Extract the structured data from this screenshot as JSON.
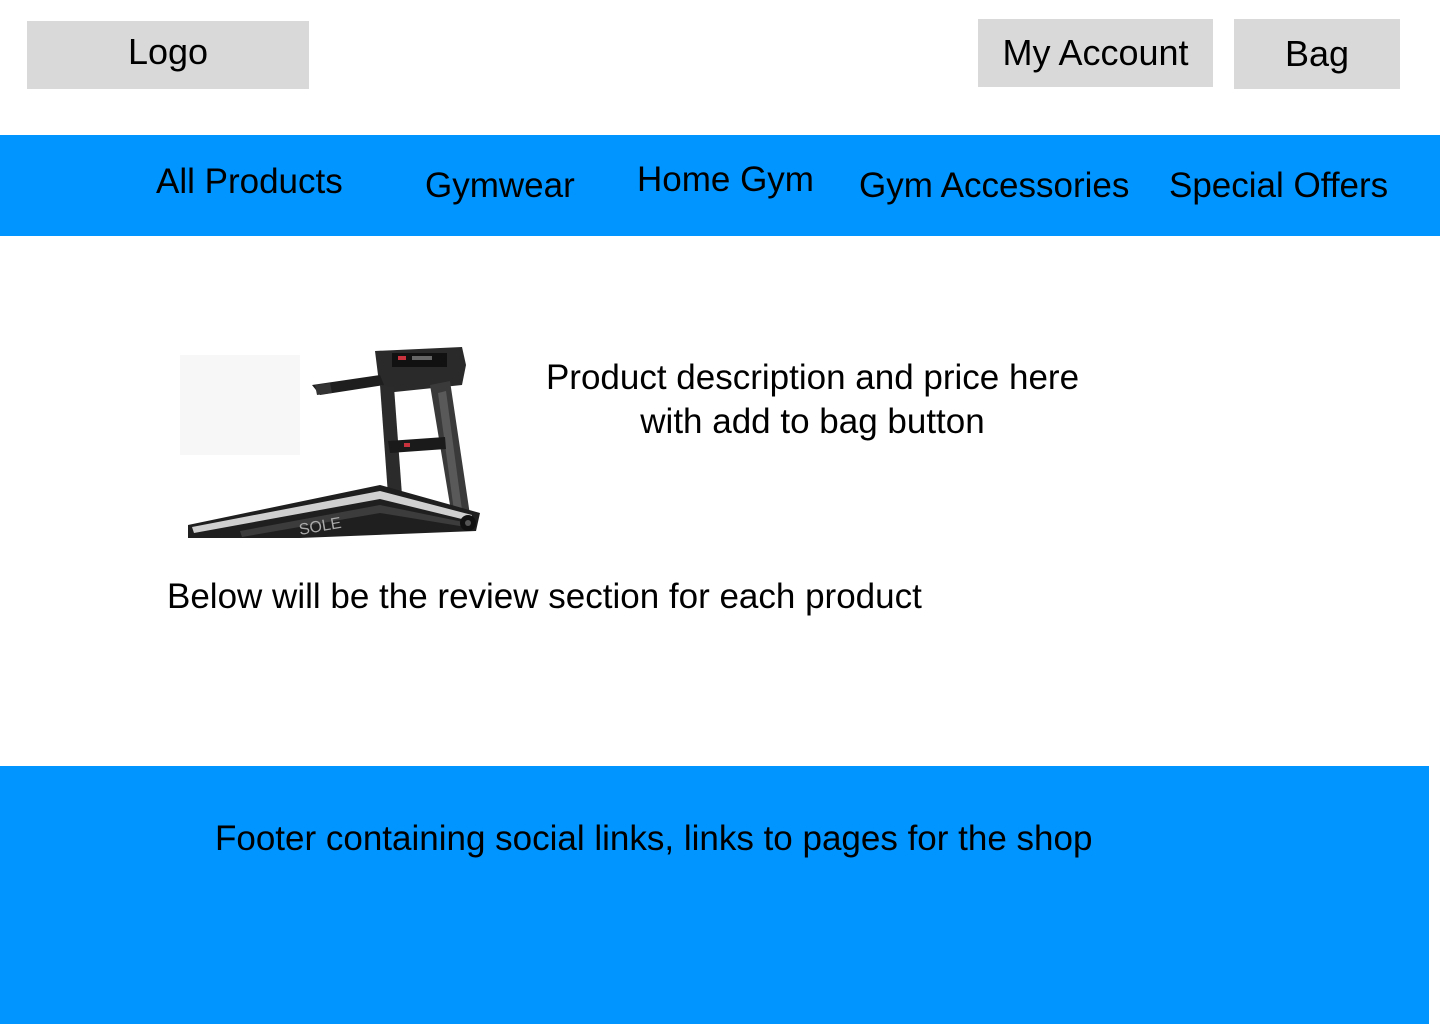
{
  "header": {
    "logo_label": "Logo",
    "account_label": "My Account",
    "bag_label": "Bag"
  },
  "nav": {
    "items": [
      {
        "label": "All Products"
      },
      {
        "label": "Gymwear"
      },
      {
        "label": "Home Gym"
      },
      {
        "label": "Gym Accessories"
      },
      {
        "label": "Special Offers"
      }
    ]
  },
  "product": {
    "image_icon": "treadmill-image",
    "description_line1": "Product description and price here",
    "description_line2": "with add to bag button"
  },
  "reviews": {
    "text": "Below will be the review section for each product"
  },
  "footer": {
    "text": "Footer containing social links, links to pages for the shop"
  },
  "colors": {
    "accent": "#0095ff",
    "placeholder": "#d9d9d9"
  }
}
